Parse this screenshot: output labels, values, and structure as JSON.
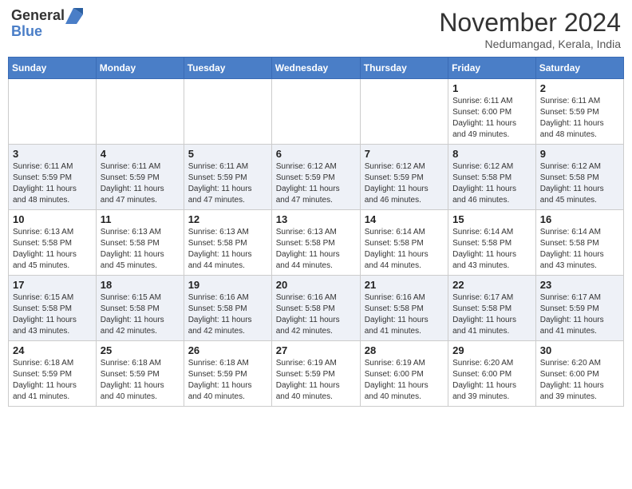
{
  "header": {
    "logo_line1": "General",
    "logo_line2": "Blue",
    "month": "November 2024",
    "location": "Nedumangad, Kerala, India"
  },
  "days_of_week": [
    "Sunday",
    "Monday",
    "Tuesday",
    "Wednesday",
    "Thursday",
    "Friday",
    "Saturday"
  ],
  "weeks": [
    [
      {
        "day": "",
        "info": ""
      },
      {
        "day": "",
        "info": ""
      },
      {
        "day": "",
        "info": ""
      },
      {
        "day": "",
        "info": ""
      },
      {
        "day": "",
        "info": ""
      },
      {
        "day": "1",
        "info": "Sunrise: 6:11 AM\nSunset: 6:00 PM\nDaylight: 11 hours\nand 49 minutes."
      },
      {
        "day": "2",
        "info": "Sunrise: 6:11 AM\nSunset: 5:59 PM\nDaylight: 11 hours\nand 48 minutes."
      }
    ],
    [
      {
        "day": "3",
        "info": "Sunrise: 6:11 AM\nSunset: 5:59 PM\nDaylight: 11 hours\nand 48 minutes."
      },
      {
        "day": "4",
        "info": "Sunrise: 6:11 AM\nSunset: 5:59 PM\nDaylight: 11 hours\nand 47 minutes."
      },
      {
        "day": "5",
        "info": "Sunrise: 6:11 AM\nSunset: 5:59 PM\nDaylight: 11 hours\nand 47 minutes."
      },
      {
        "day": "6",
        "info": "Sunrise: 6:12 AM\nSunset: 5:59 PM\nDaylight: 11 hours\nand 47 minutes."
      },
      {
        "day": "7",
        "info": "Sunrise: 6:12 AM\nSunset: 5:59 PM\nDaylight: 11 hours\nand 46 minutes."
      },
      {
        "day": "8",
        "info": "Sunrise: 6:12 AM\nSunset: 5:58 PM\nDaylight: 11 hours\nand 46 minutes."
      },
      {
        "day": "9",
        "info": "Sunrise: 6:12 AM\nSunset: 5:58 PM\nDaylight: 11 hours\nand 45 minutes."
      }
    ],
    [
      {
        "day": "10",
        "info": "Sunrise: 6:13 AM\nSunset: 5:58 PM\nDaylight: 11 hours\nand 45 minutes."
      },
      {
        "day": "11",
        "info": "Sunrise: 6:13 AM\nSunset: 5:58 PM\nDaylight: 11 hours\nand 45 minutes."
      },
      {
        "day": "12",
        "info": "Sunrise: 6:13 AM\nSunset: 5:58 PM\nDaylight: 11 hours\nand 44 minutes."
      },
      {
        "day": "13",
        "info": "Sunrise: 6:13 AM\nSunset: 5:58 PM\nDaylight: 11 hours\nand 44 minutes."
      },
      {
        "day": "14",
        "info": "Sunrise: 6:14 AM\nSunset: 5:58 PM\nDaylight: 11 hours\nand 44 minutes."
      },
      {
        "day": "15",
        "info": "Sunrise: 6:14 AM\nSunset: 5:58 PM\nDaylight: 11 hours\nand 43 minutes."
      },
      {
        "day": "16",
        "info": "Sunrise: 6:14 AM\nSunset: 5:58 PM\nDaylight: 11 hours\nand 43 minutes."
      }
    ],
    [
      {
        "day": "17",
        "info": "Sunrise: 6:15 AM\nSunset: 5:58 PM\nDaylight: 11 hours\nand 43 minutes."
      },
      {
        "day": "18",
        "info": "Sunrise: 6:15 AM\nSunset: 5:58 PM\nDaylight: 11 hours\nand 42 minutes."
      },
      {
        "day": "19",
        "info": "Sunrise: 6:16 AM\nSunset: 5:58 PM\nDaylight: 11 hours\nand 42 minutes."
      },
      {
        "day": "20",
        "info": "Sunrise: 6:16 AM\nSunset: 5:58 PM\nDaylight: 11 hours\nand 42 minutes."
      },
      {
        "day": "21",
        "info": "Sunrise: 6:16 AM\nSunset: 5:58 PM\nDaylight: 11 hours\nand 41 minutes."
      },
      {
        "day": "22",
        "info": "Sunrise: 6:17 AM\nSunset: 5:58 PM\nDaylight: 11 hours\nand 41 minutes."
      },
      {
        "day": "23",
        "info": "Sunrise: 6:17 AM\nSunset: 5:59 PM\nDaylight: 11 hours\nand 41 minutes."
      }
    ],
    [
      {
        "day": "24",
        "info": "Sunrise: 6:18 AM\nSunset: 5:59 PM\nDaylight: 11 hours\nand 41 minutes."
      },
      {
        "day": "25",
        "info": "Sunrise: 6:18 AM\nSunset: 5:59 PM\nDaylight: 11 hours\nand 40 minutes."
      },
      {
        "day": "26",
        "info": "Sunrise: 6:18 AM\nSunset: 5:59 PM\nDaylight: 11 hours\nand 40 minutes."
      },
      {
        "day": "27",
        "info": "Sunrise: 6:19 AM\nSunset: 5:59 PM\nDaylight: 11 hours\nand 40 minutes."
      },
      {
        "day": "28",
        "info": "Sunrise: 6:19 AM\nSunset: 6:00 PM\nDaylight: 11 hours\nand 40 minutes."
      },
      {
        "day": "29",
        "info": "Sunrise: 6:20 AM\nSunset: 6:00 PM\nDaylight: 11 hours\nand 39 minutes."
      },
      {
        "day": "30",
        "info": "Sunrise: 6:20 AM\nSunset: 6:00 PM\nDaylight: 11 hours\nand 39 minutes."
      }
    ]
  ]
}
